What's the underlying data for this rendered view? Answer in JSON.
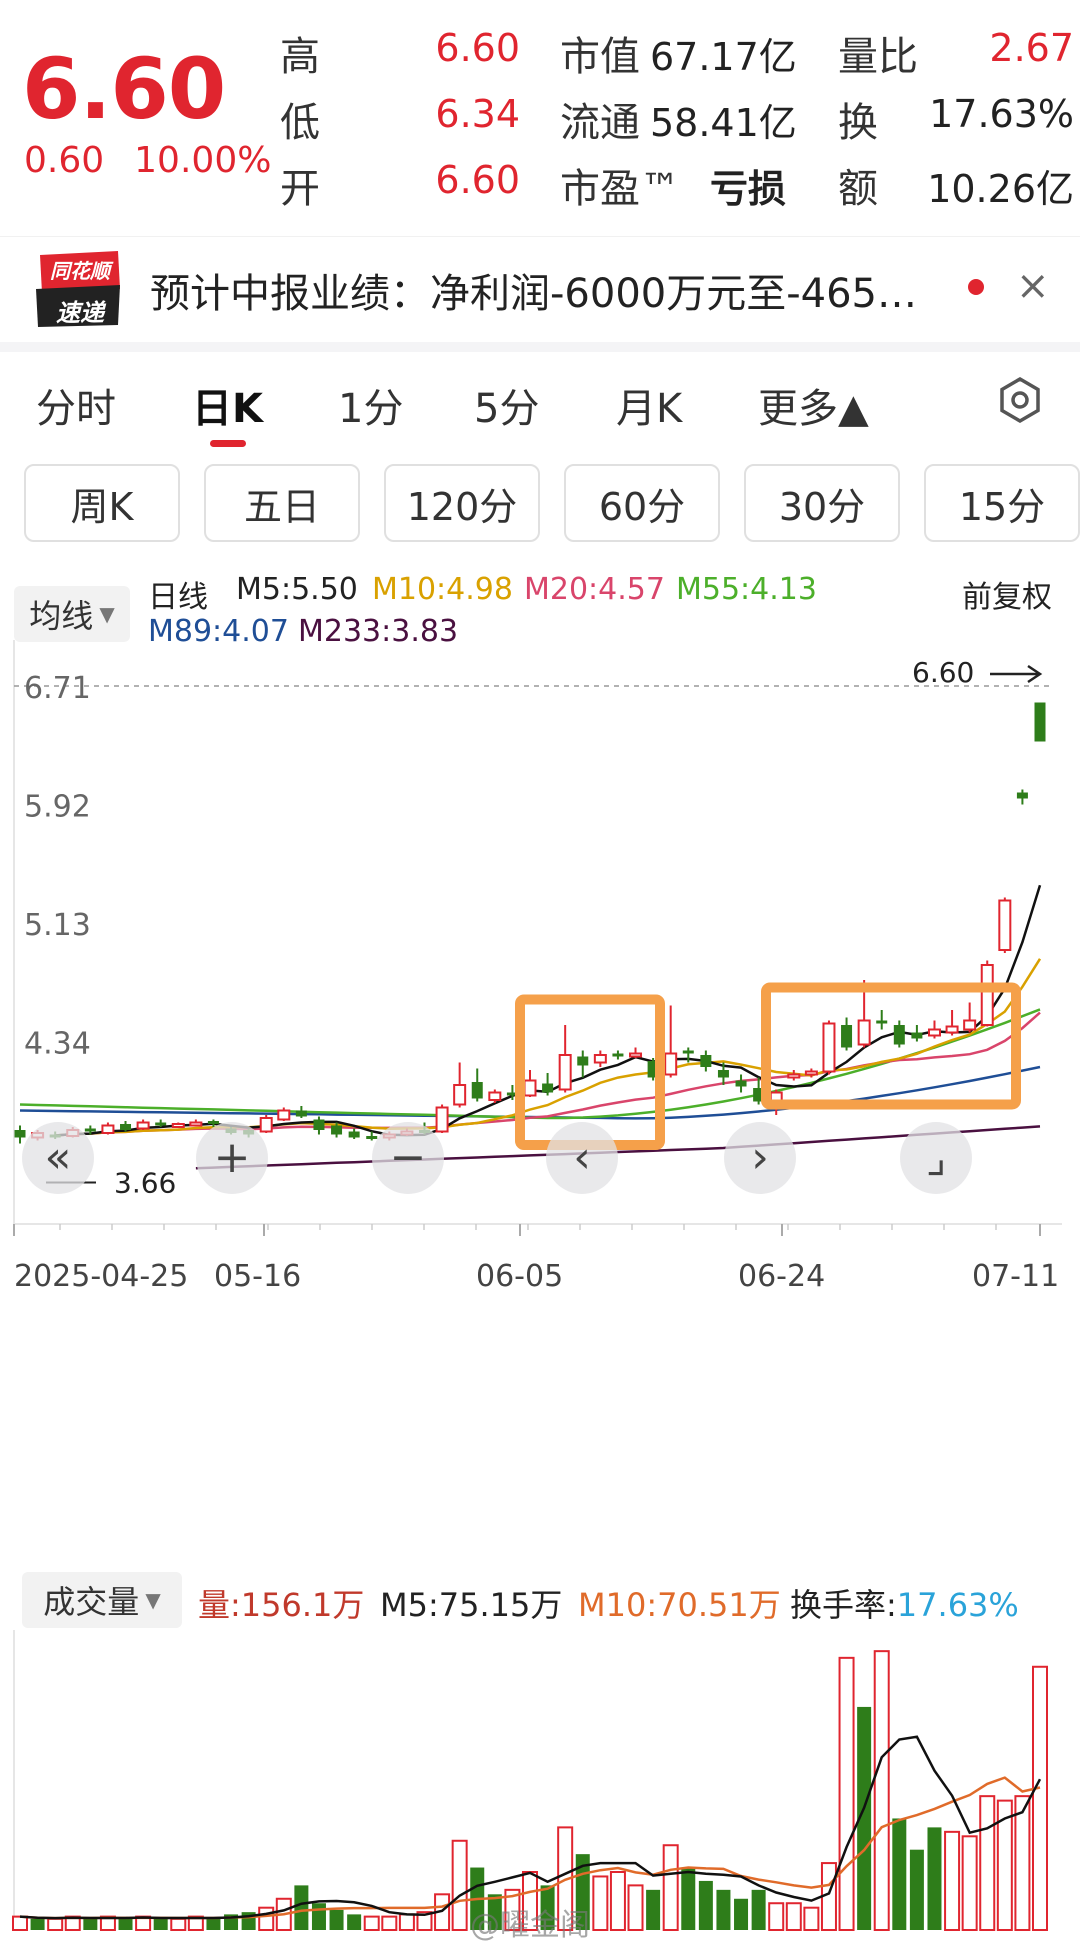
{
  "quote": {
    "price": "6.60",
    "change": "0.60",
    "change_pct": "10.00%",
    "rows": [
      {
        "label1": "高",
        "val1": "6.60",
        "label2": "市值",
        "val2": "67.17亿",
        "label3": "量比",
        "val3": "2.67"
      },
      {
        "label1": "低",
        "val1": "6.34",
        "label2": "流通",
        "val2": "58.41亿",
        "label3": "换",
        "val3": "17.63%"
      },
      {
        "label1": "开",
        "val1": "6.60",
        "label2": "市盈™",
        "val2": "亏损",
        "label3": "额",
        "val3": "10.26亿"
      }
    ]
  },
  "news": {
    "logo_top": "同花顺",
    "logo_bottom": "速递",
    "text": "预计中报业绩：净利润-6000万元至-465…",
    "close": "×"
  },
  "tabs": [
    "分时",
    "日K",
    "1分",
    "5分",
    "月K",
    "更多▲"
  ],
  "pills": [
    "周K",
    "五日",
    "120分",
    "60分",
    "30分",
    "15分"
  ],
  "ma_legend": {
    "selector": "均线",
    "title": "日线",
    "items": [
      {
        "label": "M5:5.50",
        "color": "#111111"
      },
      {
        "label": "M10:4.98",
        "color": "#d9a100"
      },
      {
        "label": "M20:4.57",
        "color": "#d9456b"
      },
      {
        "label": "M55:4.13",
        "color": "#4caf2a"
      },
      {
        "label": "M89:4.07",
        "color": "#1f4e96"
      },
      {
        "label": "M233:3.83",
        "color": "#4a1040"
      }
    ],
    "adjust": "前复权"
  },
  "chart_data": {
    "type": "candlestick",
    "y_ticks": [
      "6.71",
      "5.92",
      "5.13",
      "4.34"
    ],
    "x_ticks": [
      "2025-04-25",
      "05-16",
      "06-05",
      "06-24",
      "07-11"
    ],
    "ylim": [
      3.35,
      6.71
    ],
    "last_price_label": "6.60",
    "low_label": "3.66",
    "candles": [
      {
        "o": 3.75,
        "c": 3.7,
        "h": 3.78,
        "l": 3.66
      },
      {
        "o": 3.7,
        "c": 3.73,
        "h": 3.75,
        "l": 3.68
      },
      {
        "o": 3.72,
        "c": 3.71,
        "h": 3.74,
        "l": 3.69
      },
      {
        "o": 3.71,
        "c": 3.75,
        "h": 3.77,
        "l": 3.7
      },
      {
        "o": 3.76,
        "c": 3.74,
        "h": 3.78,
        "l": 3.72
      },
      {
        "o": 3.73,
        "c": 3.78,
        "h": 3.8,
        "l": 3.72
      },
      {
        "o": 3.79,
        "c": 3.75,
        "h": 3.81,
        "l": 3.74
      },
      {
        "o": 3.76,
        "c": 3.8,
        "h": 3.82,
        "l": 3.75
      },
      {
        "o": 3.8,
        "c": 3.78,
        "h": 3.82,
        "l": 3.77
      },
      {
        "o": 3.78,
        "c": 3.79,
        "h": 3.8,
        "l": 3.77
      },
      {
        "o": 3.79,
        "c": 3.8,
        "h": 3.82,
        "l": 3.78
      },
      {
        "o": 3.81,
        "c": 3.79,
        "h": 3.82,
        "l": 3.77
      },
      {
        "o": 3.76,
        "c": 3.73,
        "h": 3.77,
        "l": 3.72
      },
      {
        "o": 3.75,
        "c": 3.72,
        "h": 3.76,
        "l": 3.7
      },
      {
        "o": 3.74,
        "c": 3.83,
        "h": 3.85,
        "l": 3.73
      },
      {
        "o": 3.82,
        "c": 3.88,
        "h": 3.9,
        "l": 3.81
      },
      {
        "o": 3.88,
        "c": 3.84,
        "h": 3.91,
        "l": 3.83
      },
      {
        "o": 3.82,
        "c": 3.75,
        "h": 3.84,
        "l": 3.72
      },
      {
        "o": 3.78,
        "c": 3.72,
        "h": 3.8,
        "l": 3.7
      },
      {
        "o": 3.74,
        "c": 3.7,
        "h": 3.76,
        "l": 3.69
      },
      {
        "o": 3.71,
        "c": 3.7,
        "h": 3.74,
        "l": 3.68
      },
      {
        "o": 3.7,
        "c": 3.72,
        "h": 3.74,
        "l": 3.68
      },
      {
        "o": 3.72,
        "c": 3.74,
        "h": 3.76,
        "l": 3.71
      },
      {
        "o": 3.75,
        "c": 3.73,
        "h": 3.8,
        "l": 3.72
      },
      {
        "o": 3.74,
        "c": 3.9,
        "h": 3.92,
        "l": 3.73
      },
      {
        "o": 3.92,
        "c": 4.05,
        "h": 4.2,
        "l": 3.9
      },
      {
        "o": 4.07,
        "c": 3.96,
        "h": 4.16,
        "l": 3.94
      },
      {
        "o": 3.95,
        "c": 4.0,
        "h": 4.02,
        "l": 3.93
      },
      {
        "o": 4.0,
        "c": 3.98,
        "h": 4.05,
        "l": 3.95
      },
      {
        "o": 3.98,
        "c": 4.08,
        "h": 4.15,
        "l": 3.97
      },
      {
        "o": 4.06,
        "c": 4.0,
        "h": 4.13,
        "l": 3.98
      },
      {
        "o": 4.02,
        "c": 4.25,
        "h": 4.45,
        "l": 4.0
      },
      {
        "o": 4.24,
        "c": 4.18,
        "h": 4.28,
        "l": 4.1
      },
      {
        "o": 4.2,
        "c": 4.25,
        "h": 4.28,
        "l": 4.17
      },
      {
        "o": 4.26,
        "c": 4.24,
        "h": 4.28,
        "l": 4.22
      },
      {
        "o": 4.25,
        "c": 4.26,
        "h": 4.3,
        "l": 4.23
      },
      {
        "o": 4.21,
        "c": 4.1,
        "h": 4.23,
        "l": 4.08
      },
      {
        "o": 4.12,
        "c": 4.26,
        "h": 4.58,
        "l": 4.1
      },
      {
        "o": 4.28,
        "c": 4.26,
        "h": 4.3,
        "l": 4.2
      },
      {
        "o": 4.25,
        "c": 4.17,
        "h": 4.28,
        "l": 4.14
      },
      {
        "o": 4.15,
        "c": 4.1,
        "h": 4.2,
        "l": 4.05
      },
      {
        "o": 4.08,
        "c": 4.04,
        "h": 4.12,
        "l": 4.0
      },
      {
        "o": 4.03,
        "c": 3.94,
        "h": 4.1,
        "l": 3.92
      },
      {
        "o": 3.92,
        "c": 4.0,
        "h": 4.02,
        "l": 3.85
      },
      {
        "o": 4.1,
        "c": 4.12,
        "h": 4.15,
        "l": 4.08
      },
      {
        "o": 4.12,
        "c": 4.14,
        "h": 4.16,
        "l": 4.1
      },
      {
        "o": 4.14,
        "c": 4.46,
        "h": 4.48,
        "l": 4.12
      },
      {
        "o": 4.45,
        "c": 4.3,
        "h": 4.5,
        "l": 4.28
      },
      {
        "o": 4.32,
        "c": 4.48,
        "h": 4.75,
        "l": 4.3
      },
      {
        "o": 4.48,
        "c": 4.46,
        "h": 4.55,
        "l": 4.42
      },
      {
        "o": 4.45,
        "c": 4.32,
        "h": 4.48,
        "l": 4.3
      },
      {
        "o": 4.4,
        "c": 4.36,
        "h": 4.45,
        "l": 4.34
      },
      {
        "o": 4.38,
        "c": 4.42,
        "h": 4.48,
        "l": 4.36
      },
      {
        "o": 4.4,
        "c": 4.44,
        "h": 4.55,
        "l": 4.38
      },
      {
        "o": 4.42,
        "c": 4.48,
        "h": 4.6,
        "l": 4.4
      },
      {
        "o": 4.45,
        "c": 4.85,
        "h": 4.88,
        "l": 4.44
      },
      {
        "o": 4.95,
        "c": 5.28,
        "h": 5.3,
        "l": 4.93
      },
      {
        "o": 6.0,
        "c": 5.96,
        "h": 6.02,
        "l": 5.92
      },
      {
        "o": 6.6,
        "c": 6.34,
        "h": 6.6,
        "l": 6.34
      }
    ],
    "highlight_boxes": 2
  },
  "nav_buttons": {
    "rewind": "«",
    "zoom_in": "+",
    "zoom_out": "−",
    "prev": "‹",
    "next": "›",
    "fullscreen": "⌟"
  },
  "volume": {
    "selector": "成交量",
    "vol": "量:156.1万",
    "m5": "M5:75.15万",
    "m10": "M10:70.51万",
    "turnover_label": "换手率:",
    "turnover_value": "17.63%",
    "bars": [
      6,
      5,
      5,
      6,
      5,
      6,
      5,
      6,
      5,
      5,
      6,
      5,
      7,
      8,
      10,
      14,
      20,
      12,
      9,
      7,
      6,
      6,
      7,
      8,
      16,
      40,
      28,
      16,
      18,
      26,
      20,
      46,
      34,
      24,
      26,
      20,
      18,
      38,
      28,
      22,
      18,
      14,
      18,
      12,
      12,
      10,
      30,
      122,
      100,
      125,
      50,
      36,
      46,
      44,
      42,
      60,
      58,
      60,
      118
    ],
    "colors": [
      "r",
      "g",
      "r",
      "r",
      "g",
      "r",
      "g",
      "r",
      "g",
      "r",
      "r",
      "g",
      "g",
      "g",
      "r",
      "r",
      "g",
      "g",
      "g",
      "g",
      "r",
      "r",
      "r",
      "r",
      "r",
      "r",
      "g",
      "g",
      "r",
      "r",
      "g",
      "r",
      "g",
      "r",
      "r",
      "r",
      "g",
      "r",
      "g",
      "g",
      "g",
      "g",
      "g",
      "r",
      "r",
      "r",
      "r",
      "r",
      "g",
      "r",
      "g",
      "g",
      "g",
      "r",
      "r",
      "r",
      "r",
      "r",
      "r"
    ]
  },
  "watermark": "@曜金阁"
}
